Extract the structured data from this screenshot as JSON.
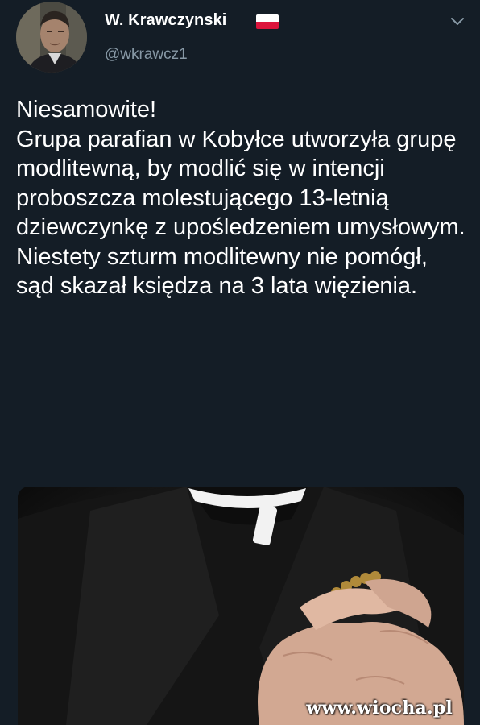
{
  "tweet": {
    "author": {
      "display_name": "W. Krawczynski",
      "handle": "@wkrawcz1",
      "flag_icon": "poland-flag-icon"
    },
    "menu_icon": "chevron-down-icon",
    "text": "Niesamowite!\nGrupa parafian w Kobyłce utworzyła grupę modlitewną, by modlić się w intencji proboszcza molestującego 13-letnią dziewczynkę z upośledzeniem umysłowym.\nNiestety szturm modlitewny nie pomógł, sąd skazał księdza na 3 lata więzienia."
  },
  "watermark": "www.wiocha.pl",
  "colors": {
    "background": "#141d26",
    "text": "#ffffff",
    "secondary_text": "#8899a6",
    "flag_red": "#dc143c"
  }
}
